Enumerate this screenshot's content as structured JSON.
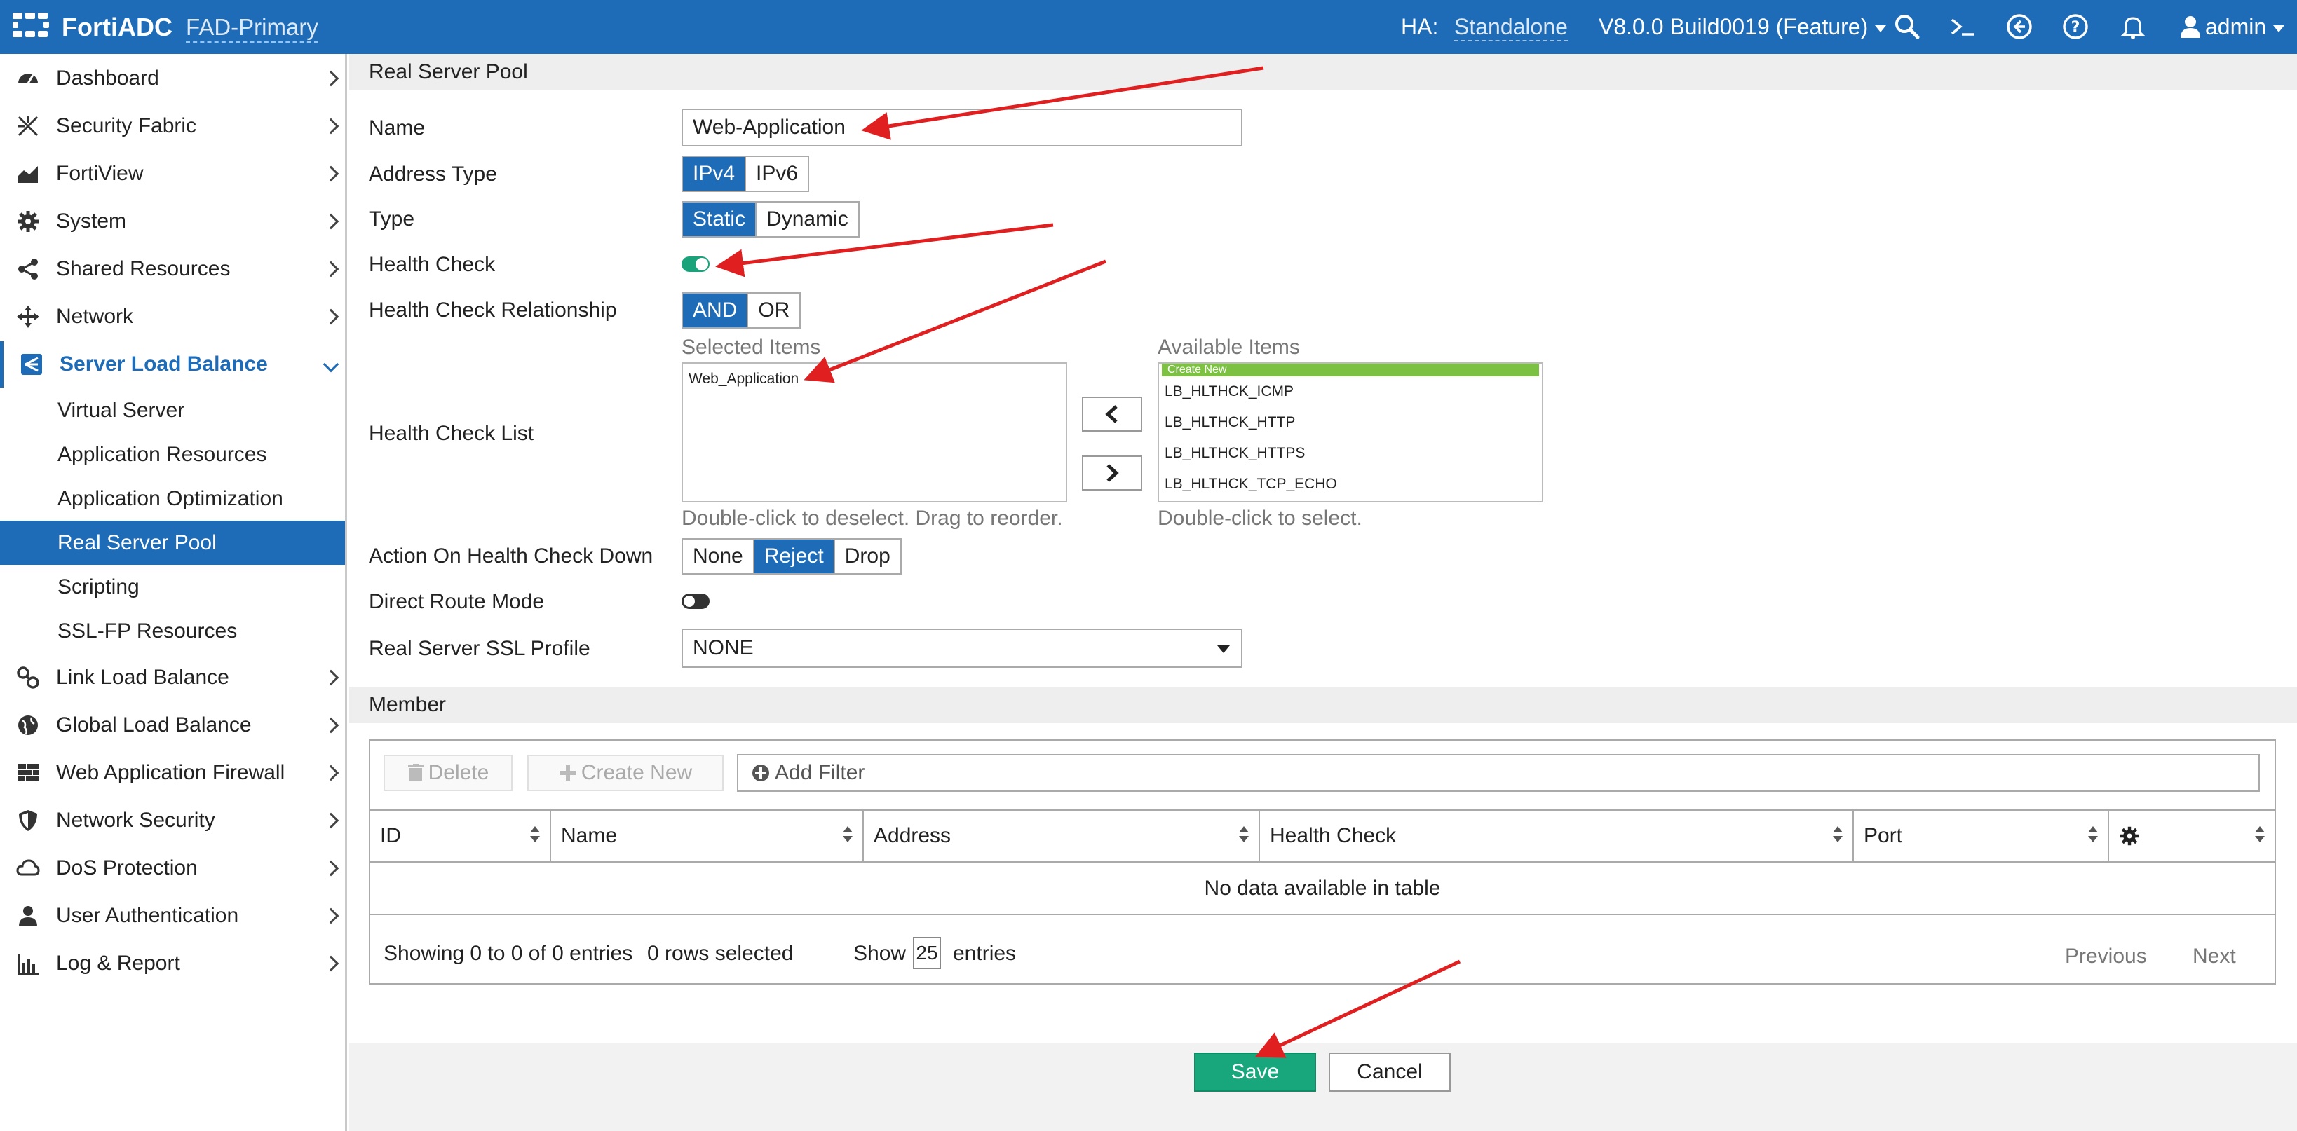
{
  "topbar": {
    "brand": "FortiADC",
    "device": "FAD-Primary",
    "ha_label": "HA:",
    "ha_value": "Standalone",
    "version": "V8.0.0 Build0019 (Feature)",
    "user": "admin"
  },
  "sidebar": {
    "items": [
      {
        "label": "Dashboard",
        "icon": "dashboard-icon"
      },
      {
        "label": "Security Fabric",
        "icon": "security-fabric-icon"
      },
      {
        "label": "FortiView",
        "icon": "chart-icon"
      },
      {
        "label": "System",
        "icon": "gear-icon"
      },
      {
        "label": "Shared Resources",
        "icon": "share-icon"
      },
      {
        "label": "Network",
        "icon": "network-icon"
      },
      {
        "label": "Server Load Balance",
        "icon": "load-balance-icon"
      },
      {
        "label": "Link Load Balance",
        "icon": "link-icon"
      },
      {
        "label": "Global Load Balance",
        "icon": "globe-icon"
      },
      {
        "label": "Web Application Firewall",
        "icon": "firewall-icon"
      },
      {
        "label": "Network Security",
        "icon": "shield-icon"
      },
      {
        "label": "DoS Protection",
        "icon": "cloud-icon"
      },
      {
        "label": "User Authentication",
        "icon": "user-icon"
      },
      {
        "label": "Log & Report",
        "icon": "report-icon"
      }
    ],
    "sub_items": [
      {
        "label": "Virtual Server"
      },
      {
        "label": "Application Resources"
      },
      {
        "label": "Application Optimization"
      },
      {
        "label": "Real Server Pool"
      },
      {
        "label": "Scripting"
      },
      {
        "label": "SSL-FP Resources"
      }
    ]
  },
  "form": {
    "section_title": "Real Server Pool",
    "name_label": "Name",
    "name_value": "Web-Application",
    "address_type_label": "Address Type",
    "address_type_options": [
      "IPv4",
      "IPv6"
    ],
    "type_label": "Type",
    "type_options": [
      "Static",
      "Dynamic"
    ],
    "health_check_label": "Health Check",
    "health_check_on": true,
    "relationship_label": "Health Check Relationship",
    "relationship_options": [
      "AND",
      "OR"
    ],
    "hc_list_label": "Health Check List",
    "selected_caption": "Selected Items",
    "selected_items": [
      "Web_Application"
    ],
    "selected_hint": "Double-click to deselect. Drag to reorder.",
    "available_caption": "Available Items",
    "available_items": [
      "Create New",
      "LB_HLTHCK_ICMP",
      "LB_HLTHCK_HTTP",
      "LB_HLTHCK_HTTPS",
      "LB_HLTHCK_TCP_ECHO"
    ],
    "available_hint": "Double-click to select.",
    "action_label": "Action On Health Check Down",
    "action_options": [
      "None",
      "Reject",
      "Drop"
    ],
    "direct_route_label": "Direct Route Mode",
    "direct_route_on": false,
    "ssl_profile_label": "Real Server SSL Profile",
    "ssl_profile_value": "NONE"
  },
  "member": {
    "section_title": "Member",
    "delete_label": "Delete",
    "create_new_label": "Create New",
    "filter_label": "Add Filter",
    "columns": [
      "ID",
      "Name",
      "Address",
      "Health Check",
      "Port"
    ],
    "no_data": "No data available in table",
    "showing": "Showing 0 to 0 of 0 entries",
    "rows_selected": "0 rows selected",
    "show_label": "Show",
    "page_size": "25",
    "entries_label": "entries",
    "previous": "Previous",
    "next": "Next"
  },
  "actions": {
    "save": "Save",
    "cancel": "Cancel"
  },
  "colors": {
    "accent": "#1e6bb8",
    "toggle_on": "#1aa37a",
    "save": "#18a67c",
    "annotation_arrow": "#e02020"
  }
}
